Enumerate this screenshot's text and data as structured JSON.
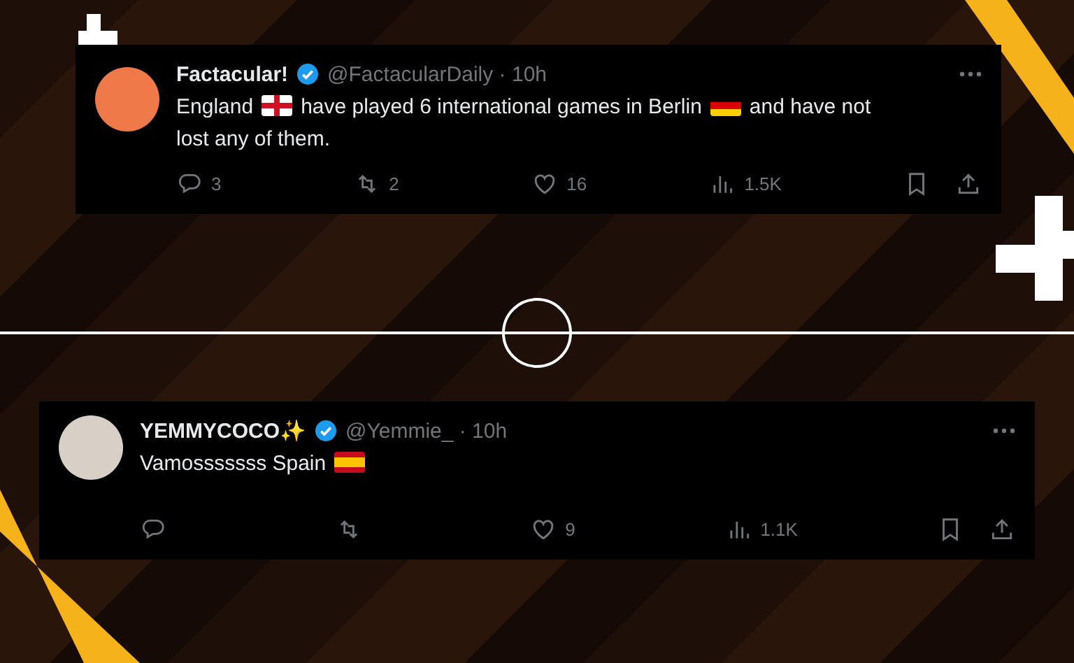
{
  "tweets": [
    {
      "kind": "logo-avatar",
      "name": "Factacular!",
      "verified": true,
      "meta": "@FactacularDaily · 10h",
      "body": [
        [
          {
            "kind": "text",
            "text": "England"
          },
          {
            "kind": "england-flag"
          },
          {
            "kind": "text",
            "text": "have played 6 international games in Berlin"
          },
          {
            "kind": "germany-flag"
          },
          {
            "kind": "text",
            "text": "and have not"
          }
        ],
        [
          {
            "kind": "text",
            "text": "lost any of them."
          }
        ]
      ],
      "replies": "3",
      "reposts": "2",
      "likes": "16",
      "views": "1.5K"
    },
    {
      "kind": "photo-avatar",
      "name": "YEMMYCOCO✨",
      "verified": true,
      "meta": "@Yemmie_ · 10h",
      "body": [
        [
          {
            "kind": "text",
            "text": "Vamosssssss Spain"
          },
          {
            "kind": "spain-flag"
          }
        ]
      ],
      "likes": "9",
      "views": "1.1K"
    }
  ]
}
